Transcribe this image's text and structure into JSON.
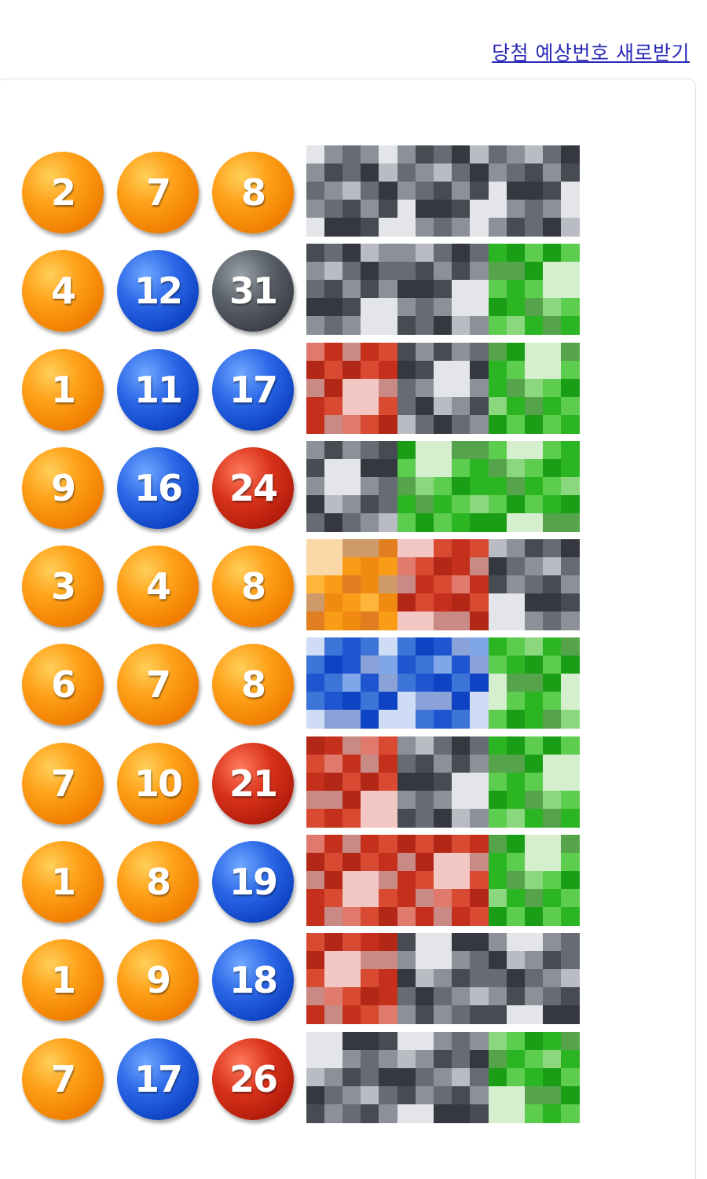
{
  "header": {
    "refresh_link": "당첨 예상번호 새로받기"
  },
  "colors": {
    "orange": "#f59200",
    "blue": "#1b52d6",
    "red": "#c4250f",
    "gray": "#474c53",
    "green": "#2cb523",
    "link": "#2a2ab8"
  },
  "rows": [
    {
      "numbers": [
        {
          "n": "2",
          "c": "orange"
        },
        {
          "n": "7",
          "c": "orange"
        },
        {
          "n": "8",
          "c": "orange"
        }
      ],
      "hidden": [
        "gray",
        "gray",
        "gray"
      ]
    },
    {
      "numbers": [
        {
          "n": "4",
          "c": "orange"
        },
        {
          "n": "12",
          "c": "blue"
        },
        {
          "n": "31",
          "c": "gray"
        }
      ],
      "hidden": [
        "gray",
        "gray",
        "green"
      ]
    },
    {
      "numbers": [
        {
          "n": "1",
          "c": "orange"
        },
        {
          "n": "11",
          "c": "blue"
        },
        {
          "n": "17",
          "c": "blue"
        }
      ],
      "hidden": [
        "red",
        "gray",
        "green"
      ]
    },
    {
      "numbers": [
        {
          "n": "9",
          "c": "orange"
        },
        {
          "n": "16",
          "c": "blue"
        },
        {
          "n": "24",
          "c": "red"
        }
      ],
      "hidden": [
        "gray",
        "green",
        "green"
      ]
    },
    {
      "numbers": [
        {
          "n": "3",
          "c": "orange"
        },
        {
          "n": "4",
          "c": "orange"
        },
        {
          "n": "8",
          "c": "orange"
        }
      ],
      "hidden": [
        "orange",
        "red",
        "gray"
      ]
    },
    {
      "numbers": [
        {
          "n": "6",
          "c": "orange"
        },
        {
          "n": "7",
          "c": "orange"
        },
        {
          "n": "8",
          "c": "orange"
        }
      ],
      "hidden": [
        "blue",
        "blue",
        "green"
      ]
    },
    {
      "numbers": [
        {
          "n": "7",
          "c": "orange"
        },
        {
          "n": "10",
          "c": "orange"
        },
        {
          "n": "21",
          "c": "red"
        }
      ],
      "hidden": [
        "red",
        "gray",
        "green"
      ]
    },
    {
      "numbers": [
        {
          "n": "1",
          "c": "orange"
        },
        {
          "n": "8",
          "c": "orange"
        },
        {
          "n": "19",
          "c": "blue"
        }
      ],
      "hidden": [
        "red",
        "red",
        "green"
      ]
    },
    {
      "numbers": [
        {
          "n": "1",
          "c": "orange"
        },
        {
          "n": "9",
          "c": "orange"
        },
        {
          "n": "18",
          "c": "blue"
        }
      ],
      "hidden": [
        "red",
        "gray",
        "gray"
      ]
    },
    {
      "numbers": [
        {
          "n": "7",
          "c": "orange"
        },
        {
          "n": "17",
          "c": "blue"
        },
        {
          "n": "26",
          "c": "red"
        }
      ],
      "hidden": [
        "gray",
        "gray",
        "green"
      ]
    }
  ]
}
